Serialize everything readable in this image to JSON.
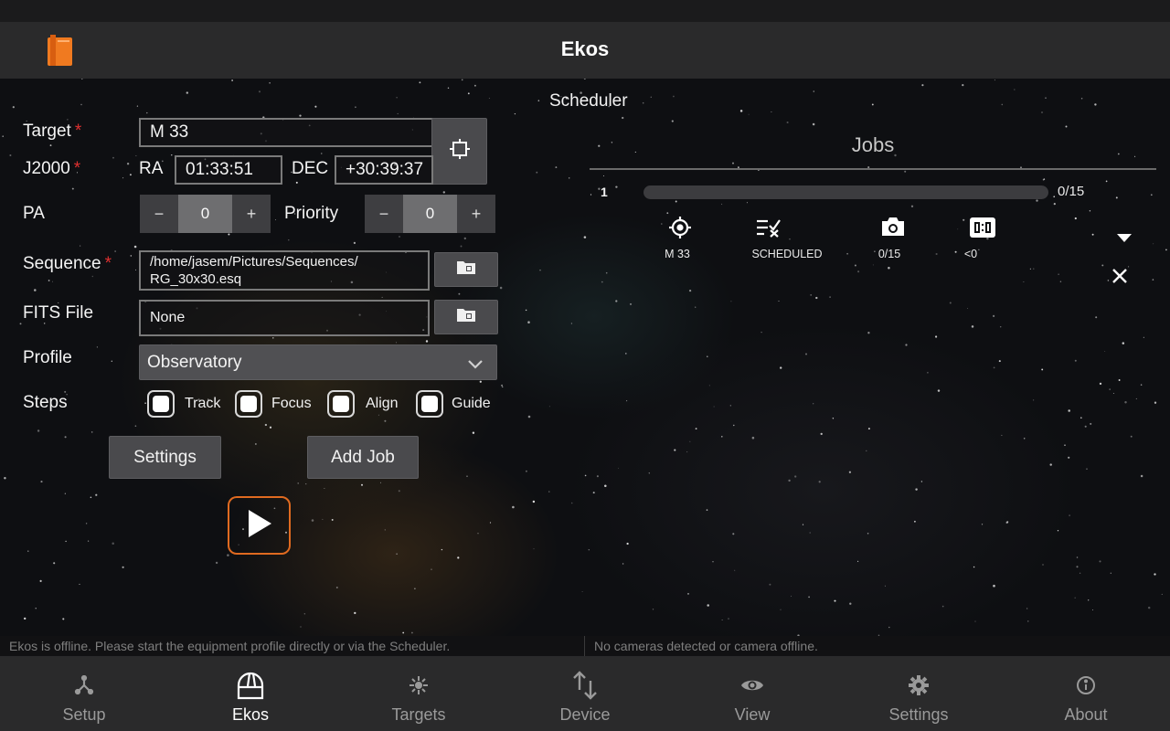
{
  "app": {
    "title": "Ekos"
  },
  "form": {
    "target_label": "Target",
    "target_value": "M 33",
    "j2000_label": "J2000",
    "ra_label": "RA",
    "ra_value": "01:33:51",
    "dec_label": "DEC",
    "dec_value": "+30:39:37",
    "pa_label": "PA",
    "pa_value": "0",
    "priority_label": "Priority",
    "priority_value": "0",
    "sequence_label": "Sequence",
    "sequence_value_line1": "/home/jasem/Pictures/Sequences/",
    "sequence_value_line2": "RG_30x30.esq",
    "fits_label": "FITS File",
    "fits_value": "None",
    "profile_label": "Profile",
    "profile_value": "Observatory",
    "steps_label": "Steps",
    "steps": [
      {
        "label": "Track",
        "checked": false
      },
      {
        "label": "Focus",
        "checked": false
      },
      {
        "label": "Align",
        "checked": false
      },
      {
        "label": "Guide",
        "checked": false
      }
    ],
    "settings_button": "Settings",
    "add_job_button": "Add Job",
    "minus": "−",
    "plus": "+",
    "required_mark": "*"
  },
  "scheduler": {
    "title": "Scheduler",
    "jobs_title": "Jobs",
    "jobs": [
      {
        "index": "1",
        "progress_text": "0/15",
        "progress_fraction": 0,
        "target": "M 33",
        "status": "SCHEDULED",
        "captures": "0/15",
        "duration": "<0"
      }
    ]
  },
  "status": {
    "left": "Ekos is offline. Please start the equipment profile directly or via the Scheduler.",
    "right": "No cameras detected or camera offline."
  },
  "nav": [
    {
      "label": "Setup",
      "icon": "setup-icon",
      "active": false
    },
    {
      "label": "Ekos",
      "icon": "observatory-dome-icon",
      "active": true
    },
    {
      "label": "Targets",
      "icon": "targets-icon",
      "active": false
    },
    {
      "label": "Device",
      "icon": "device-arrows-icon",
      "active": false
    },
    {
      "label": "View",
      "icon": "eye-icon",
      "active": false
    },
    {
      "label": "Settings",
      "icon": "gear-icon",
      "active": false
    },
    {
      "label": "About",
      "icon": "info-icon",
      "active": false
    }
  ],
  "colors": {
    "accent": "#e06a20",
    "required": "#e03030",
    "bar": "#2a2a2b"
  }
}
